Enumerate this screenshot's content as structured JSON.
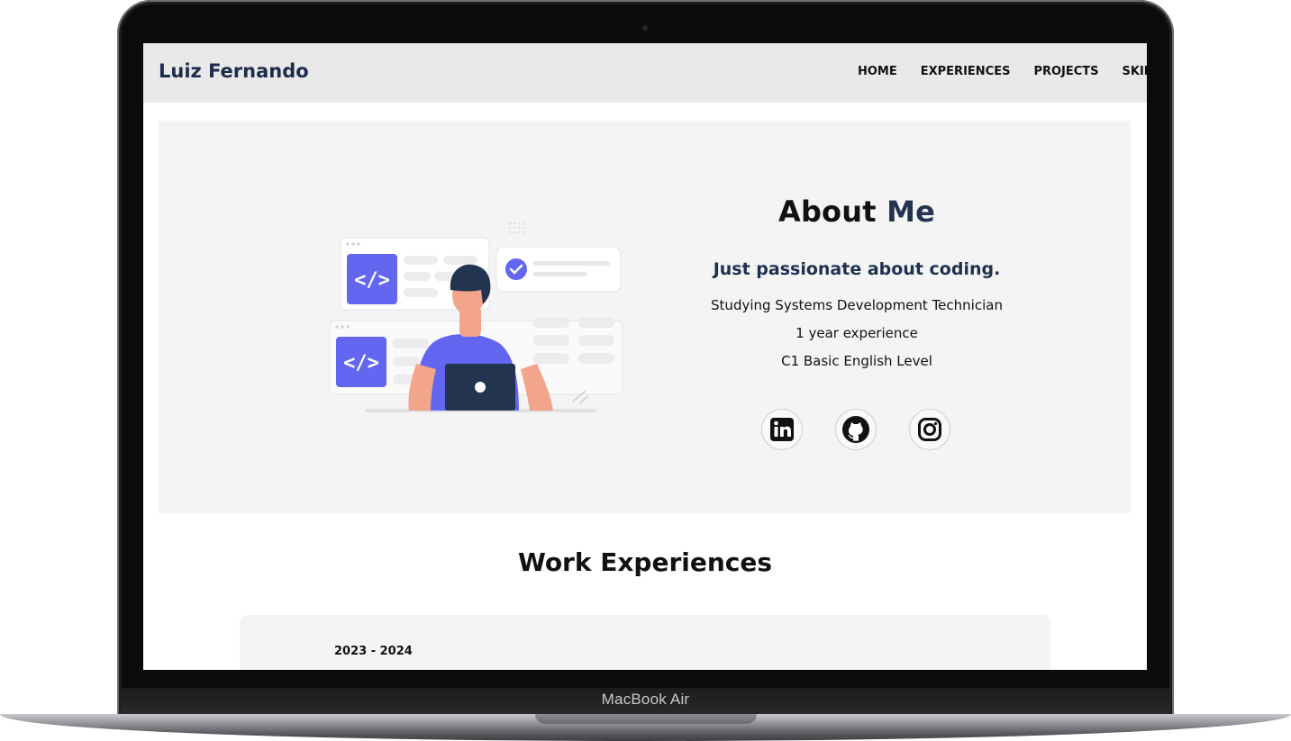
{
  "navbar": {
    "brand": "Luiz Fernando",
    "links": [
      "HOME",
      "EXPERIENCES",
      "PROJECTS",
      "SKILLS"
    ]
  },
  "about": {
    "title_part1": "About ",
    "title_part2": "Me",
    "subtitle": "Just passionate about coding.",
    "lines": [
      "Studying Systems Development Technician",
      "1 year experience",
      "C1 Basic English Level"
    ],
    "socials": [
      "linkedin-icon",
      "github-icon",
      "instagram-icon"
    ]
  },
  "work": {
    "title": "Work Experiences",
    "items": [
      {
        "years": "2023 - 2024"
      }
    ]
  },
  "device": {
    "label": "MacBook Air"
  },
  "colors": {
    "navy": "#1d2c4a",
    "accent_purple": "#6366f1",
    "section_bg": "#f4f4f4",
    "nav_bg": "#e9e9e9"
  }
}
